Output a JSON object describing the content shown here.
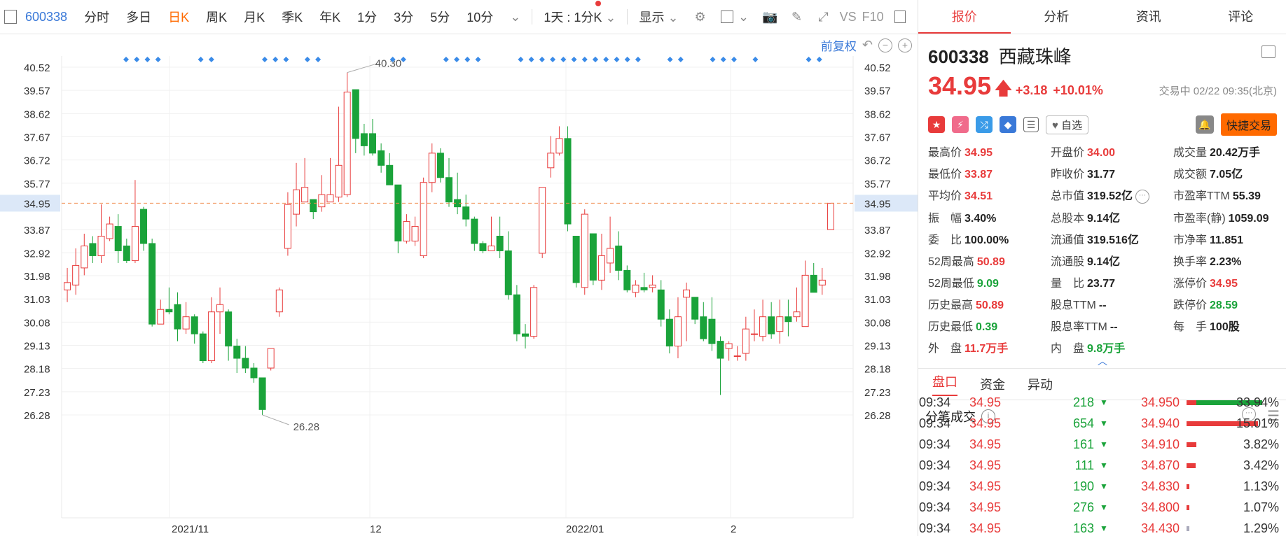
{
  "toolbar": {
    "code": "600338",
    "periods": [
      "分时",
      "多日",
      "日K",
      "周K",
      "月K",
      "季K",
      "年K",
      "1分",
      "3分",
      "5分",
      "10分"
    ],
    "active_period": "日K",
    "interval_select": "1天 : 1分K",
    "display_label": "显示",
    "vs_label": "VS",
    "f10_label": "F10"
  },
  "chart": {
    "adjust_label": "前复权",
    "price_axis": [
      "40.52",
      "39.57",
      "38.62",
      "37.67",
      "36.72",
      "35.77",
      "34.95",
      "33.87",
      "32.92",
      "31.98",
      "31.03",
      "30.08",
      "29.13",
      "28.18",
      "27.23",
      "26.28"
    ],
    "current_price_label": "34.95",
    "date_labels": [
      "2021/11",
      "12",
      "2022/01",
      "2"
    ],
    "high_annotation": "40.30",
    "low_annotation": "26.28"
  },
  "chart_data": {
    "type": "candlestick",
    "ylim": [
      26.28,
      40.52
    ],
    "current_price": 34.95,
    "candles": [
      [
        31.4,
        31.7,
        30.9,
        32.3
      ],
      [
        31.6,
        32.4,
        31.2,
        33.1
      ],
      [
        32.3,
        33.2,
        32.0,
        33.7
      ],
      [
        33.3,
        32.8,
        32.5,
        33.6
      ],
      [
        32.8,
        33.6,
        32.5,
        34.9
      ],
      [
        33.5,
        34.1,
        33.4,
        34.4
      ],
      [
        34.0,
        33.0,
        32.5,
        34.5
      ],
      [
        33.2,
        32.6,
        32.5,
        33.5
      ],
      [
        32.6,
        34.0,
        32.5,
        35.9
      ],
      [
        34.7,
        33.3,
        33.0,
        34.8
      ],
      [
        33.3,
        30.0,
        29.9,
        33.5
      ],
      [
        30.0,
        30.6,
        30.0,
        31.0
      ],
      [
        30.6,
        30.5,
        30.4,
        31.5
      ],
      [
        30.8,
        29.8,
        29.3,
        31.3
      ],
      [
        29.8,
        30.3,
        29.6,
        30.9
      ],
      [
        30.3,
        29.6,
        29.2,
        30.4
      ],
      [
        29.6,
        28.5,
        28.4,
        29.7
      ],
      [
        28.5,
        30.5,
        28.4,
        31.1
      ],
      [
        30.5,
        30.8,
        29.6,
        31.5
      ],
      [
        30.5,
        29.1,
        28.5,
        30.6
      ],
      [
        29.1,
        28.6,
        28.0,
        29.4
      ],
      [
        28.6,
        28.2,
        28.0,
        29.1
      ],
      [
        28.2,
        27.8,
        27.6,
        28.4
      ],
      [
        27.8,
        26.5,
        26.28,
        27.8
      ],
      [
        28.2,
        29.0,
        28.1,
        29.0
      ],
      [
        30.5,
        31.4,
        30.3,
        31.5
      ],
      [
        33.1,
        34.9,
        32.8,
        35.4
      ],
      [
        34.5,
        35.5,
        34.0,
        36.6
      ],
      [
        35.0,
        35.6,
        35.0,
        36.8
      ],
      [
        35.1,
        34.6,
        34.3,
        35.1
      ],
      [
        34.8,
        35.3,
        34.6,
        36.1
      ],
      [
        35.0,
        35.3,
        35.0,
        36.8
      ],
      [
        35.2,
        36.5,
        35.0,
        38.9
      ],
      [
        35.3,
        39.5,
        35.2,
        40.3
      ],
      [
        39.6,
        37.6,
        37.0,
        39.6
      ],
      [
        37.8,
        37.3,
        36.9,
        38.2
      ],
      [
        37.8,
        37.0,
        36.9,
        38.4
      ],
      [
        37.1,
        36.5,
        36.2,
        37.4
      ],
      [
        36.5,
        35.7,
        35.7,
        37.0
      ],
      [
        35.7,
        33.4,
        32.9,
        35.7
      ],
      [
        33.4,
        34.2,
        33.3,
        34.5
      ],
      [
        33.4,
        34.0,
        33.2,
        34.4
      ],
      [
        32.8,
        35.8,
        32.7,
        36.0
      ],
      [
        35.8,
        37.0,
        35.4,
        37.4
      ],
      [
        37.0,
        36.0,
        35.8,
        37.2
      ],
      [
        36.0,
        35.0,
        34.8,
        36.8
      ],
      [
        35.1,
        34.8,
        34.5,
        36.2
      ],
      [
        34.8,
        34.3,
        34.0,
        35.3
      ],
      [
        34.3,
        33.3,
        33.0,
        34.4
      ],
      [
        33.3,
        33.0,
        32.9,
        33.4
      ],
      [
        33.0,
        33.2,
        33.0,
        34.4
      ],
      [
        33.6,
        33.0,
        32.7,
        34.4
      ],
      [
        33.0,
        31.2,
        31.0,
        33.8
      ],
      [
        31.2,
        29.6,
        29.3,
        31.6
      ],
      [
        29.6,
        29.5,
        29.0,
        30.0
      ],
      [
        29.5,
        31.5,
        29.4,
        31.6
      ],
      [
        32.9,
        35.6,
        32.7,
        35.6
      ],
      [
        36.4,
        37.0,
        36.0,
        37.7
      ],
      [
        37.0,
        37.6,
        36.9,
        38.1
      ],
      [
        37.6,
        34.1,
        33.8,
        38.1
      ],
      [
        33.6,
        31.7,
        31.5,
        33.6
      ],
      [
        31.5,
        34.5,
        31.2,
        34.7
      ],
      [
        33.7,
        31.8,
        31.6,
        33.7
      ],
      [
        31.8,
        32.8,
        31.4,
        33.7
      ],
      [
        32.5,
        33.1,
        32.1,
        34.4
      ],
      [
        33.2,
        32.2,
        31.8,
        33.8
      ],
      [
        32.2,
        31.4,
        31.3,
        32.4
      ],
      [
        31.3,
        31.6,
        31.1,
        31.8
      ],
      [
        31.5,
        31.4,
        31.3,
        32.1
      ],
      [
        31.5,
        31.6,
        31.3,
        32.0
      ],
      [
        31.4,
        30.2,
        29.9,
        31.8
      ],
      [
        30.2,
        29.1,
        28.8,
        30.6
      ],
      [
        29.1,
        30.3,
        28.6,
        31.1
      ],
      [
        31.1,
        31.4,
        29.3,
        31.7
      ],
      [
        31.1,
        30.2,
        30.0,
        31.1
      ],
      [
        30.3,
        29.4,
        29.3,
        30.9
      ],
      [
        30.2,
        29.2,
        28.9,
        31.1
      ],
      [
        29.3,
        28.6,
        27.1,
        29.5
      ],
      [
        29.0,
        29.2,
        28.5,
        29.3
      ],
      [
        28.7,
        28.7,
        28.5,
        29.1
      ],
      [
        28.8,
        29.8,
        28.5,
        30.3
      ],
      [
        29.6,
        29.6,
        29.3,
        30.6
      ],
      [
        29.5,
        30.3,
        29.3,
        31.0
      ],
      [
        30.3,
        29.6,
        29.4,
        30.9
      ],
      [
        29.7,
        30.3,
        29.2,
        31.0
      ],
      [
        30.3,
        30.1,
        29.5,
        31.0
      ],
      [
        30.3,
        30.5,
        30.1,
        31.5
      ],
      [
        29.9,
        32.0,
        29.9,
        32.6
      ],
      [
        32.0,
        31.3,
        31.3,
        32.5
      ],
      [
        31.6,
        31.8,
        31.2,
        32.3
      ],
      [
        33.87,
        34.95,
        33.87,
        34.95
      ]
    ]
  },
  "header": {
    "tabs": [
      "报价",
      "分析",
      "资讯",
      "评论"
    ],
    "code": "600338",
    "name": "西藏珠峰",
    "price": "34.95",
    "change": "+3.18",
    "change_pct": "+10.01%",
    "status": "交易中 02/22 09:35(北京)",
    "watch_label": "自选",
    "quick_trade_label": "快捷交易"
  },
  "quote_grid": [
    [
      {
        "l": "最高价",
        "v": "34.95",
        "c": "red"
      },
      {
        "l": "开盘价",
        "v": "34.00",
        "c": "red"
      },
      {
        "l": "成交量",
        "v": "20.42万手",
        "c": "black"
      }
    ],
    [
      {
        "l": "最低价",
        "v": "33.87",
        "c": "red"
      },
      {
        "l": "昨收价",
        "v": "31.77",
        "c": "black"
      },
      {
        "l": "成交额",
        "v": "7.05亿",
        "c": "black"
      }
    ],
    [
      {
        "l": "平均价",
        "v": "34.51",
        "c": "red"
      },
      {
        "l": "总市值",
        "v": "319.52亿",
        "c": "black"
      },
      {
        "l": "市盈率TTM",
        "v": "55.39",
        "c": "black"
      }
    ],
    [
      {
        "l": "振　幅",
        "v": "3.40%",
        "c": "black"
      },
      {
        "l": "总股本",
        "v": "9.14亿",
        "c": "black"
      },
      {
        "l": "市盈率(静)",
        "v": "1059.09",
        "c": "black"
      }
    ],
    [
      {
        "l": "委　比",
        "v": "100.00%",
        "c": "black"
      },
      {
        "l": "流通值",
        "v": "319.516亿",
        "c": "black"
      },
      {
        "l": "市净率",
        "v": "11.851",
        "c": "black"
      }
    ],
    [
      {
        "l": "52周最高",
        "v": "50.89",
        "c": "red"
      },
      {
        "l": "流通股",
        "v": "9.14亿",
        "c": "black"
      },
      {
        "l": "换手率",
        "v": "2.23%",
        "c": "black"
      }
    ],
    [
      {
        "l": "52周最低",
        "v": "9.09",
        "c": "green"
      },
      {
        "l": "量　比",
        "v": "23.77",
        "c": "black"
      },
      {
        "l": "涨停价",
        "v": "34.95",
        "c": "red"
      }
    ],
    [
      {
        "l": "历史最高",
        "v": "50.89",
        "c": "red"
      },
      {
        "l": "股息TTM",
        "v": "--",
        "c": "black"
      },
      {
        "l": "跌停价",
        "v": "28.59",
        "c": "green"
      }
    ],
    [
      {
        "l": "历史最低",
        "v": "0.39",
        "c": "green"
      },
      {
        "l": "股息率TTM",
        "v": "--",
        "c": "black"
      },
      {
        "l": "每　手",
        "v": "100股",
        "c": "black"
      }
    ],
    [
      {
        "l": "外　盘",
        "v": "11.7万手",
        "c": "red"
      },
      {
        "l": "内　盘",
        "v": "9.8万手",
        "c": "green"
      },
      {
        "l": "",
        "v": "",
        "c": "black"
      }
    ]
  ],
  "sub_tabs": [
    "盘口",
    "资金",
    "异动"
  ],
  "ticks_title": "分笔成交",
  "ticks": [
    {
      "time": "09:34",
      "price": "34.95",
      "vol": "218",
      "p2": "34.950",
      "pct": "33.94%",
      "frac": 0.9
    },
    {
      "time": "09:34",
      "price": "34.95",
      "vol": "654",
      "p2": "34.940",
      "pct": "15.01%",
      "frac": 0.85
    },
    {
      "time": "09:34",
      "price": "34.95",
      "vol": "161",
      "p2": "34.910",
      "pct": "3.82%",
      "frac": 0.12
    },
    {
      "time": "09:34",
      "price": "34.95",
      "vol": "111",
      "p2": "34.870",
      "pct": "3.42%",
      "frac": 0.11
    },
    {
      "time": "09:34",
      "price": "34.95",
      "vol": "190",
      "p2": "34.830",
      "pct": "1.13%",
      "frac": 0.03
    },
    {
      "time": "09:34",
      "price": "34.95",
      "vol": "276",
      "p2": "34.800",
      "pct": "1.07%",
      "frac": 0.03
    },
    {
      "time": "09:34",
      "price": "34.95",
      "vol": "163",
      "p2": "34.430",
      "pct": "1.29%",
      "frac": 0.03
    }
  ]
}
